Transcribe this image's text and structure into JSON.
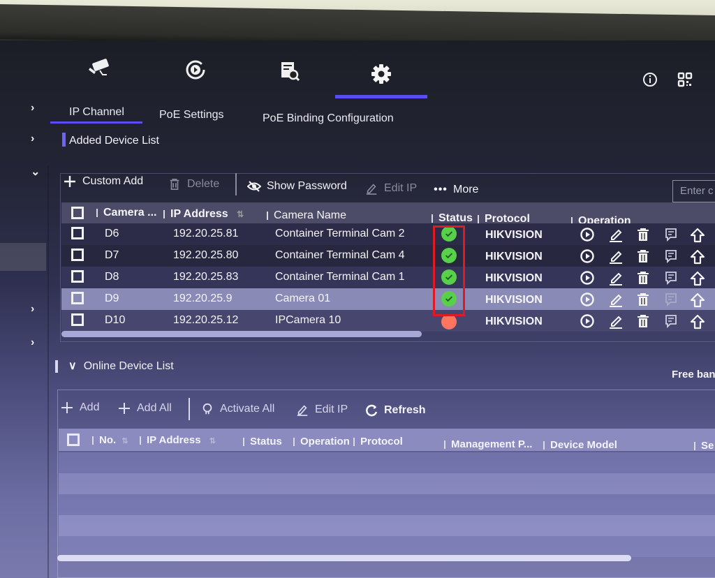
{
  "top_nav": {
    "icons": [
      "camera-icon",
      "playback-icon",
      "search-file-icon",
      "settings-gear-icon"
    ],
    "active": "settings-gear-icon",
    "right_icons": [
      "info-icon",
      "qr-code-icon"
    ]
  },
  "subtabs": [
    {
      "label": "IP Channel",
      "active": true
    },
    {
      "label": "PoE Settings",
      "active": false
    },
    {
      "label": "PoE Binding Configuration",
      "active": false
    }
  ],
  "added_device_list": {
    "title": "Added Device List",
    "toolbar": {
      "custom_add": "Custom Add",
      "delete": "Delete",
      "show_password": "Show Password",
      "edit_ip": "Edit IP",
      "more": "More",
      "search_placeholder": "Enter c"
    },
    "columns": [
      "Camera ...",
      "IP Address",
      "Camera Name",
      "Status",
      "Protocol",
      "Operation"
    ],
    "rows": [
      {
        "camera": "D6",
        "ip": "192.20.25.81",
        "name": "Container Terminal  Cam 2",
        "status": "online",
        "protocol": "HIKVISION"
      },
      {
        "camera": "D7",
        "ip": "192.20.25.80",
        "name": "Container Terminal Cam  4",
        "status": "online",
        "protocol": "HIKVISION"
      },
      {
        "camera": "D8",
        "ip": "192.20.25.83",
        "name": "Container Terminal Cam 1",
        "status": "online",
        "protocol": "HIKVISION"
      },
      {
        "camera": "D9",
        "ip": "192.20.25.9",
        "name": "Camera 01",
        "status": "online",
        "protocol": "HIKVISION"
      },
      {
        "camera": "D10",
        "ip": "192.20.25.12",
        "name": "IPCamera 10",
        "status": "offline",
        "protocol": "HIKVISION"
      }
    ]
  },
  "online_device_list": {
    "title": "Online Device List",
    "free_bandwidth_label": "Free band",
    "toolbar": {
      "add": "Add",
      "add_all": "Add All",
      "activate_all": "Activate All",
      "edit_ip": "Edit IP",
      "refresh": "Refresh"
    },
    "columns": [
      "No.",
      "IP Address",
      "Status",
      "Operation",
      "Protocol",
      "Management P...",
      "Device Model",
      "Se"
    ]
  },
  "colors": {
    "accent": "#5a4df2",
    "status_ok": "#58d04a",
    "status_err": "#ff7560",
    "highlight_box": "#e01a22"
  }
}
